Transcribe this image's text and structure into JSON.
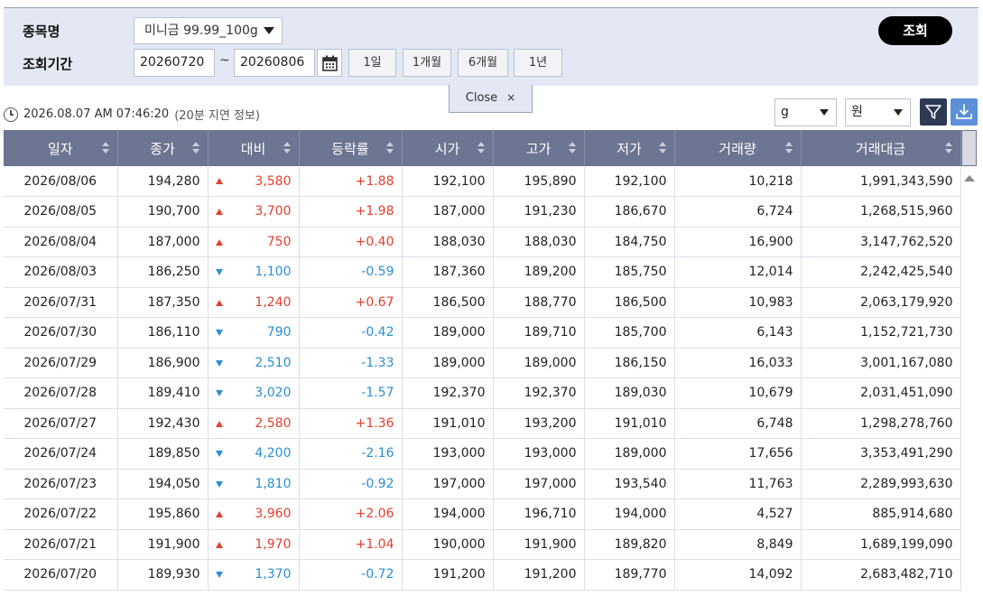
{
  "search": {
    "product_label": "종목명",
    "period_label": "조회기간",
    "product_selected": "미니금 99.99_100g",
    "date_from": "20260720",
    "date_to": "20260806",
    "tilde": "~",
    "period_buttons": [
      "1일",
      "1개월",
      "6개월",
      "1년"
    ],
    "query_button": "조회"
  },
  "close_tab": {
    "label": "Close",
    "icon": "×"
  },
  "info": {
    "timestamp": "2026.08.07 AM 07:46:20",
    "delay_note": "(20분 지연 정보)"
  },
  "units": {
    "weight_unit": "g",
    "currency_unit": "원"
  },
  "colors": {
    "up": "#e2402e",
    "down": "#2b8fd1",
    "header_bg": "#6c7591",
    "panel_bg": "#e3e8f4",
    "filter_btn": "#2e3a55",
    "download_btn": "#5b8fd8"
  },
  "table": {
    "columns": [
      "일자",
      "종가",
      "대비",
      "등락률",
      "시가",
      "고가",
      "저가",
      "거래량",
      "거래대금"
    ],
    "rows": [
      {
        "date": "2026/08/06",
        "close": "194,280",
        "dir": "up",
        "change": "3,580",
        "rate": "+1.88",
        "open": "192,100",
        "high": "195,890",
        "low": "192,100",
        "volume": "10,218",
        "amount": "1,991,343,590"
      },
      {
        "date": "2026/08/05",
        "close": "190,700",
        "dir": "up",
        "change": "3,700",
        "rate": "+1.98",
        "open": "187,000",
        "high": "191,230",
        "low": "186,670",
        "volume": "6,724",
        "amount": "1,268,515,960"
      },
      {
        "date": "2026/08/04",
        "close": "187,000",
        "dir": "up",
        "change": "750",
        "rate": "+0.40",
        "open": "188,030",
        "high": "188,030",
        "low": "184,750",
        "volume": "16,900",
        "amount": "3,147,762,520"
      },
      {
        "date": "2026/08/03",
        "close": "186,250",
        "dir": "down",
        "change": "1,100",
        "rate": "-0.59",
        "open": "187,360",
        "high": "189,200",
        "low": "185,750",
        "volume": "12,014",
        "amount": "2,242,425,540"
      },
      {
        "date": "2026/07/31",
        "close": "187,350",
        "dir": "up",
        "change": "1,240",
        "rate": "+0.67",
        "open": "186,500",
        "high": "188,770",
        "low": "186,500",
        "volume": "10,983",
        "amount": "2,063,179,920"
      },
      {
        "date": "2026/07/30",
        "close": "186,110",
        "dir": "down",
        "change": "790",
        "rate": "-0.42",
        "open": "189,000",
        "high": "189,710",
        "low": "185,700",
        "volume": "6,143",
        "amount": "1,152,721,730"
      },
      {
        "date": "2026/07/29",
        "close": "186,900",
        "dir": "down",
        "change": "2,510",
        "rate": "-1.33",
        "open": "189,000",
        "high": "189,000",
        "low": "186,150",
        "volume": "16,033",
        "amount": "3,001,167,080"
      },
      {
        "date": "2026/07/28",
        "close": "189,410",
        "dir": "down",
        "change": "3,020",
        "rate": "-1.57",
        "open": "192,370",
        "high": "192,370",
        "low": "189,030",
        "volume": "10,679",
        "amount": "2,031,451,090"
      },
      {
        "date": "2026/07/27",
        "close": "192,430",
        "dir": "up",
        "change": "2,580",
        "rate": "+1.36",
        "open": "191,010",
        "high": "193,200",
        "low": "191,010",
        "volume": "6,748",
        "amount": "1,298,278,760"
      },
      {
        "date": "2026/07/24",
        "close": "189,850",
        "dir": "down",
        "change": "4,200",
        "rate": "-2.16",
        "open": "193,000",
        "high": "193,000",
        "low": "189,000",
        "volume": "17,656",
        "amount": "3,353,491,290"
      },
      {
        "date": "2026/07/23",
        "close": "194,050",
        "dir": "down",
        "change": "1,810",
        "rate": "-0.92",
        "open": "197,000",
        "high": "197,000",
        "low": "193,540",
        "volume": "11,763",
        "amount": "2,289,993,630"
      },
      {
        "date": "2026/07/22",
        "close": "195,860",
        "dir": "up",
        "change": "3,960",
        "rate": "+2.06",
        "open": "194,000",
        "high": "196,710",
        "low": "194,000",
        "volume": "4,527",
        "amount": "885,914,680"
      },
      {
        "date": "2026/07/21",
        "close": "191,900",
        "dir": "up",
        "change": "1,970",
        "rate": "+1.04",
        "open": "190,000",
        "high": "191,900",
        "low": "189,820",
        "volume": "8,849",
        "amount": "1,689,199,090"
      },
      {
        "date": "2026/07/20",
        "close": "189,930",
        "dir": "down",
        "change": "1,370",
        "rate": "-0.72",
        "open": "191,200",
        "high": "191,200",
        "low": "189,770",
        "volume": "14,092",
        "amount": "2,683,482,710"
      }
    ]
  }
}
